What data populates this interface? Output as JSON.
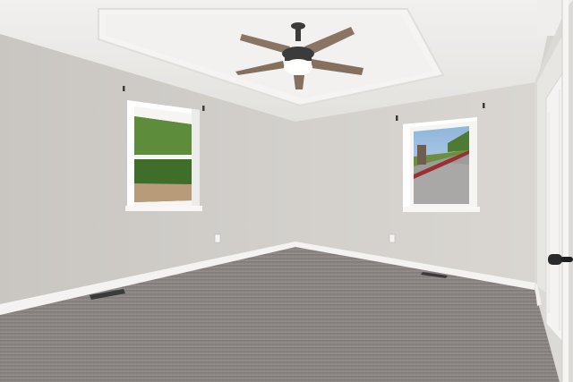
{
  "scene": {
    "palette": {
      "ceiling": "#ecebe9",
      "wall_left": "#cfccc8",
      "wall_back": "#d7d4cf",
      "trim": "#f3f2ef",
      "carpet": "#8a8583",
      "fan_blade": "#8a7565",
      "fan_body": "#3b3b3b"
    },
    "icons": [
      "ceiling-fan-icon",
      "door-handle-icon",
      "floor-vent-icon",
      "outlet-icon"
    ]
  }
}
